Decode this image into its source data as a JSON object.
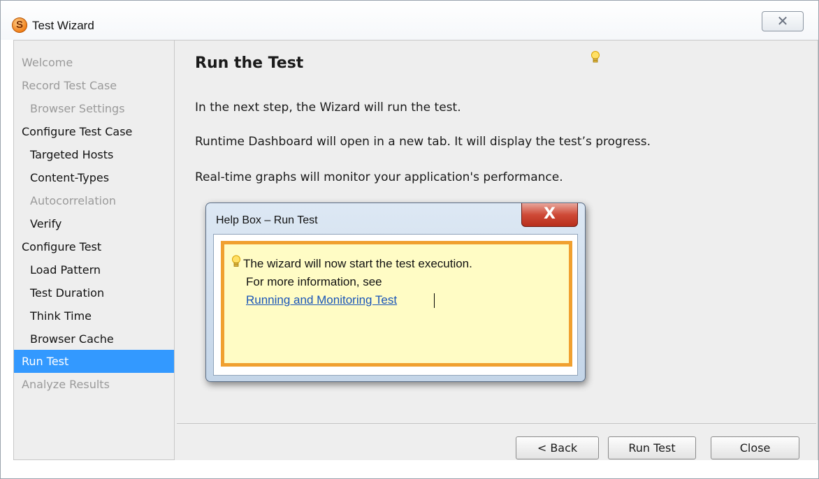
{
  "window": {
    "title": "Test Wizard",
    "close_glyph": "✕"
  },
  "sidebar": {
    "items": [
      {
        "label": "Welcome",
        "level": 0,
        "state": "disabled"
      },
      {
        "label": "Record Test Case",
        "level": 0,
        "state": "disabled"
      },
      {
        "label": "Browser Settings",
        "level": 1,
        "state": "disabled"
      },
      {
        "label": "Configure Test Case",
        "level": 0,
        "state": "enabled"
      },
      {
        "label": "Targeted Hosts",
        "level": 1,
        "state": "enabled"
      },
      {
        "label": "Content-Types",
        "level": 1,
        "state": "enabled"
      },
      {
        "label": "Autocorrelation",
        "level": 1,
        "state": "disabled"
      },
      {
        "label": "Verify",
        "level": 1,
        "state": "enabled"
      },
      {
        "label": "Configure Test",
        "level": 0,
        "state": "enabled"
      },
      {
        "label": "Load Pattern",
        "level": 1,
        "state": "enabled"
      },
      {
        "label": "Test Duration",
        "level": 1,
        "state": "enabled"
      },
      {
        "label": "Think Time",
        "level": 1,
        "state": "enabled"
      },
      {
        "label": "Browser Cache",
        "level": 1,
        "state": "enabled"
      },
      {
        "label": "Run Test",
        "level": 0,
        "state": "selected"
      },
      {
        "label": "Analyze Results",
        "level": 0,
        "state": "disabled"
      }
    ]
  },
  "main": {
    "title": "Run the Test",
    "paragraphs": [
      "In the next step, the Wizard will run the test.",
      "Runtime Dashboard will open in a new tab. It will display the test’s progress.",
      "Real-time graphs will monitor your application's performance."
    ]
  },
  "help_box": {
    "title": "Help Box – Run Test",
    "close_glyph": "X",
    "line1": "The wizard will now start the test execution.",
    "line2": "For more information, see",
    "link": "Running and Monitoring Test"
  },
  "buttons": {
    "back": "< Back",
    "run": "Run Test",
    "close": "Close"
  },
  "colors": {
    "selection": "#3399ff",
    "help_border": "#f0a030",
    "help_background": "#fffcc5",
    "link": "#1a55b8"
  }
}
